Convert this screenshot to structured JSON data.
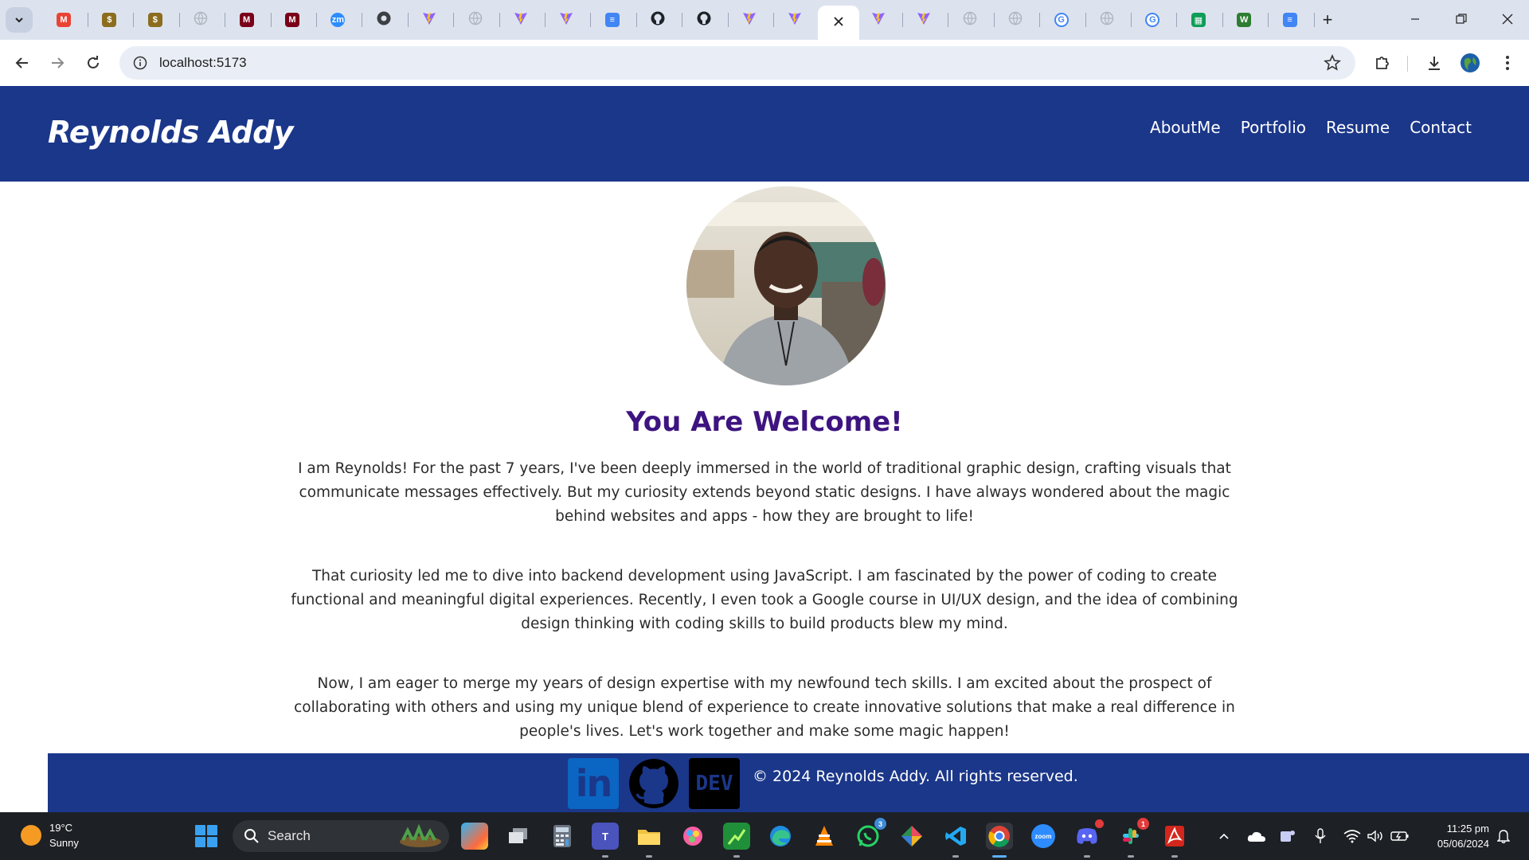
{
  "browser": {
    "tabs": [
      {
        "icon": "gmail-icon",
        "color": "#ea4335"
      },
      {
        "icon": "money-icon",
        "color": "#8c6d1f"
      },
      {
        "icon": "money-icon",
        "color": "#8c6d1f"
      },
      {
        "icon": "globe-icon",
        "color": "#b0b6c0"
      },
      {
        "icon": "umn-icon",
        "color": "#7a0019"
      },
      {
        "icon": "umn-icon",
        "color": "#7a0019"
      },
      {
        "icon": "zoom-icon",
        "color": "#2d8cff"
      },
      {
        "icon": "chrome-icon",
        "color": "#3c4043"
      },
      {
        "icon": "vite-icon",
        "color": "#a25cff"
      },
      {
        "icon": "globe-icon",
        "color": "#b0b6c0"
      },
      {
        "icon": "vite-icon",
        "color": "#a25cff"
      },
      {
        "icon": "vite-icon",
        "color": "#a25cff"
      },
      {
        "icon": "docs-icon",
        "color": "#4285f4"
      },
      {
        "icon": "github-icon",
        "color": "#1f2328"
      },
      {
        "icon": "github-icon",
        "color": "#1f2328"
      },
      {
        "icon": "vite-icon",
        "color": "#a25cff"
      },
      {
        "icon": "vite-icon",
        "color": "#a25cff"
      },
      {
        "icon": "close-icon",
        "color": "#1f1f1f",
        "active": true
      },
      {
        "icon": "vite-icon",
        "color": "#a25cff"
      },
      {
        "icon": "vite-icon",
        "color": "#a25cff"
      },
      {
        "icon": "globe-icon",
        "color": "#b0b6c0"
      },
      {
        "icon": "globe-icon",
        "color": "#b0b6c0"
      },
      {
        "icon": "google-icon",
        "color": "#4285f4"
      },
      {
        "icon": "globe-icon",
        "color": "#b0b6c0"
      },
      {
        "icon": "google-icon",
        "color": "#4285f4"
      },
      {
        "icon": "sheets-icon",
        "color": "#0f9d58"
      },
      {
        "icon": "webflow-icon",
        "color": "#2e7d32"
      },
      {
        "icon": "docs-icon",
        "color": "#4285f4"
      }
    ],
    "url": "localhost:5173"
  },
  "site": {
    "brand": "Reynolds Addy",
    "nav": [
      "AboutMe",
      "Portfolio",
      "Resume",
      "Contact"
    ],
    "welcome": "You Are Welcome!",
    "paragraphs": [
      "I am Reynolds! For the past 7 years, I've been deeply immersed in the world of traditional graphic design, crafting visuals that communicate messages effectively. But my curiosity extends beyond static designs. I have always wondered about the magic behind websites and apps - how they are brought to life!",
      "That curiosity led me to dive into backend development using JavaScript. I am fascinated by the power of coding to create functional and meaningful digital experiences. Recently, I even took a Google course in UI/UX design, and the idea of combining design thinking with coding skills to build products blew my mind.",
      "Now, I am eager to merge my years of design expertise with my newfound tech skills. I am excited about the prospect of collaborating with others and using my unique blend of experience to create innovative solutions that make a real difference in people's lives. Let's work together and make some magic happen!"
    ],
    "socials": {
      "linkedin": "in",
      "dev": "DEV"
    },
    "copyright": "© 2024 Reynolds Addy. All rights reserved.",
    "colors": {
      "header": "#1b378a",
      "welcome": "#3d1480",
      "linkedin": "#0a66c2"
    }
  },
  "taskbar": {
    "weather_temp": "19°C",
    "weather_desc": "Sunny",
    "search_label": "Search",
    "teams_label": "T",
    "whatsapp_badge": "3",
    "slack_badge": "1",
    "zoom_label": "zoom",
    "time": "11:25 pm",
    "date": "05/06/2024"
  }
}
